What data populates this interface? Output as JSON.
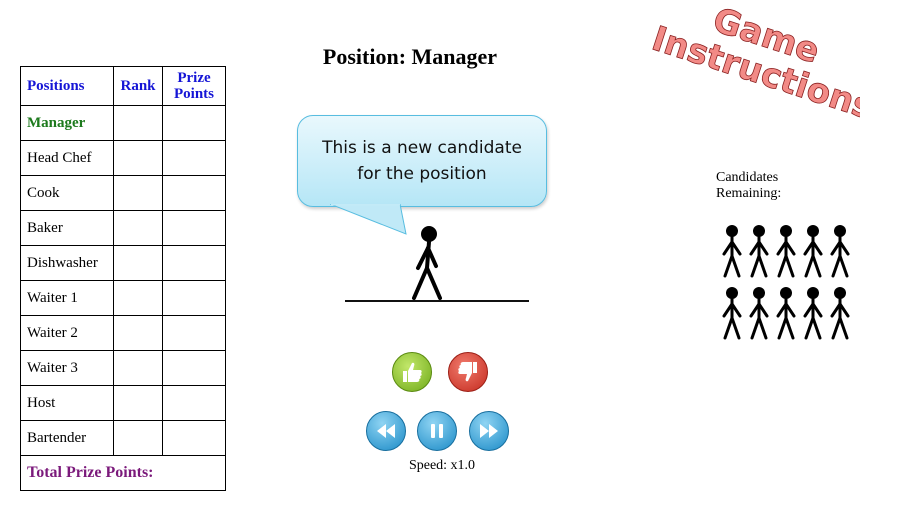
{
  "table": {
    "headers": {
      "positions": "Positions",
      "rank": "Rank",
      "prize_points": "Prize Points"
    },
    "rows": [
      {
        "position": "Manager",
        "rank": "",
        "points": ""
      },
      {
        "position": "Head Chef",
        "rank": "",
        "points": ""
      },
      {
        "position": "Cook",
        "rank": "",
        "points": ""
      },
      {
        "position": "Baker",
        "rank": "",
        "points": ""
      },
      {
        "position": "Dishwasher",
        "rank": "",
        "points": ""
      },
      {
        "position": "Waiter 1",
        "rank": "",
        "points": ""
      },
      {
        "position": "Waiter 2",
        "rank": "",
        "points": ""
      },
      {
        "position": "Waiter 3",
        "rank": "",
        "points": ""
      },
      {
        "position": "Host",
        "rank": "",
        "points": ""
      },
      {
        "position": "Bartender",
        "rank": "",
        "points": ""
      }
    ],
    "total_label": "Total Prize Points:"
  },
  "main": {
    "position_title": "Position: Manager",
    "bubble_text": "This is a new candidate for the position",
    "speed_label": "Speed: x1.0"
  },
  "logo": {
    "line1": "Game",
    "line2": "Instructions",
    "color": "#f07b7b"
  },
  "candidates": {
    "label_line1": "Candidates",
    "label_line2": "Remaining:",
    "count": 10
  },
  "icons": {
    "thumbs_up": "thumbs-up-icon",
    "thumbs_down": "thumbs-down-icon",
    "rewind": "rewind-icon",
    "pause": "pause-icon",
    "forward": "fast-forward-icon"
  },
  "colors": {
    "header_blue": "#1515d6",
    "manager_green": "#1d7a1d",
    "total_purple": "#7b1a7b",
    "thumbs_up": "#7ab51d",
    "thumbs_down": "#d6392b",
    "media_blue": "#2496d4"
  }
}
